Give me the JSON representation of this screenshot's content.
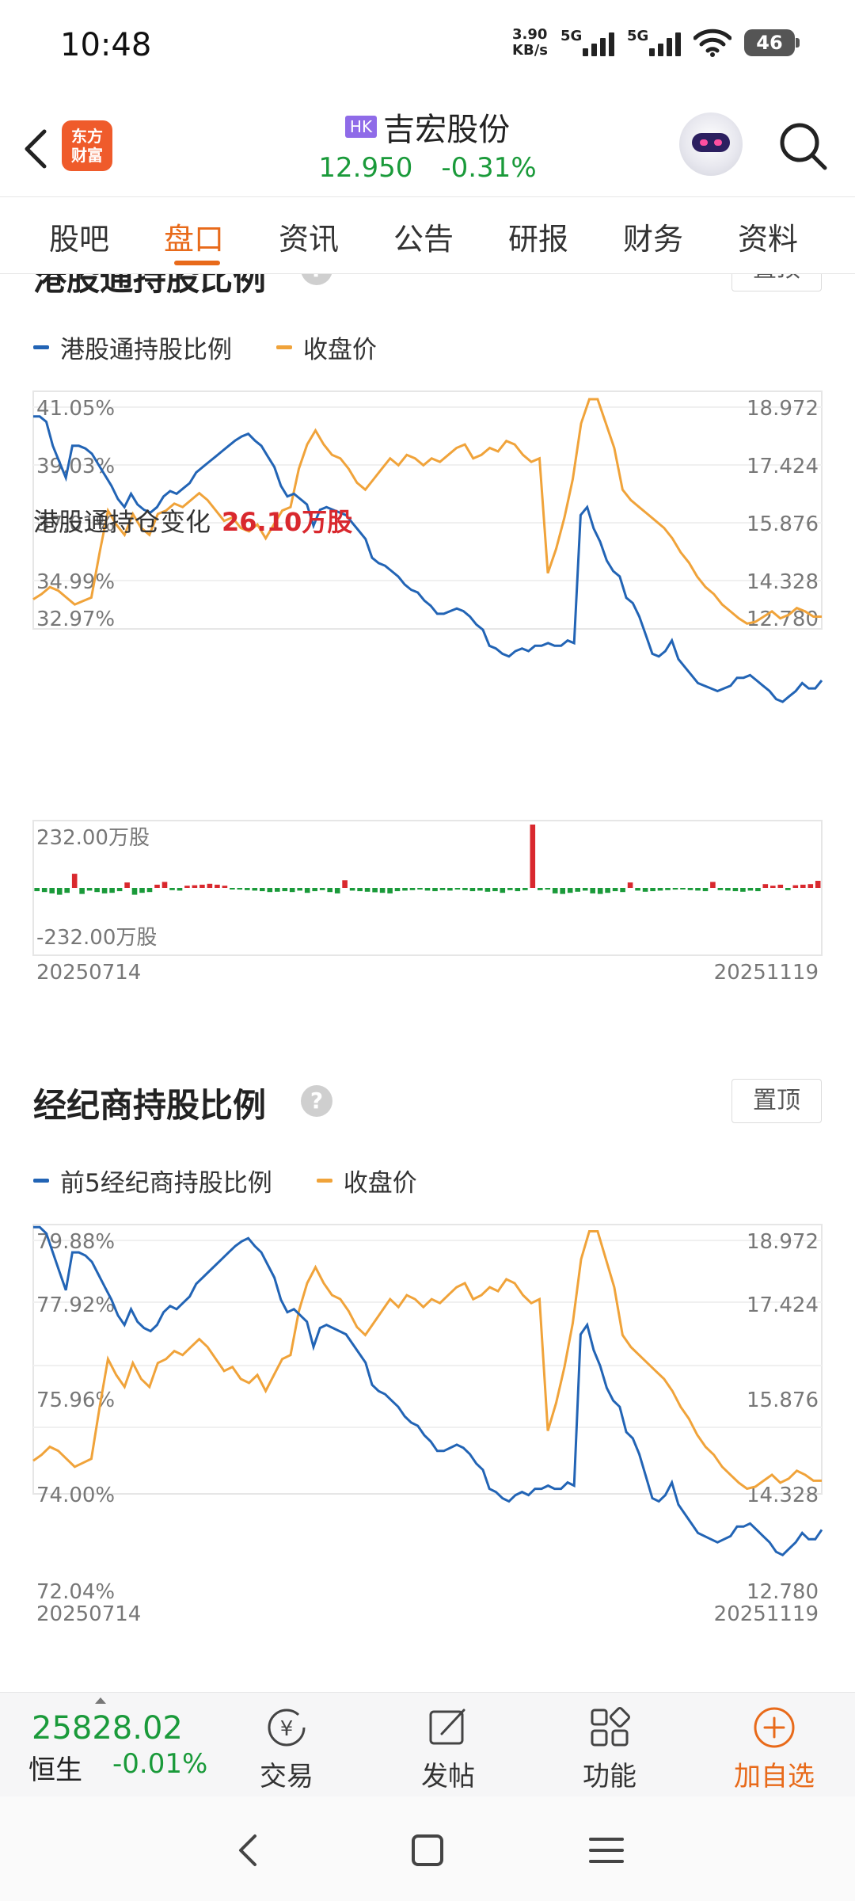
{
  "status_bar": {
    "time": "10:48",
    "net_speed_value": "3.90",
    "net_speed_unit": "KB/s",
    "sim1_label": "5G",
    "sim2_label": "5G",
    "battery": "46"
  },
  "header": {
    "logo_line1": "东方",
    "logo_line2": "财富",
    "market_badge": "HK",
    "stock_name": "吉宏股份",
    "price": "12.950",
    "change_pct": "-0.31%"
  },
  "tabs": [
    "股吧",
    "盘口",
    "资讯",
    "公告",
    "研报",
    "财务",
    "资料"
  ],
  "active_tab_index": 1,
  "colors": {
    "blue_series": "#2264b5",
    "orange_series": "#f0a33a",
    "green_down": "#1a9a3a",
    "red_up": "#d9282e",
    "accent": "#e86a1a"
  },
  "section_hk": {
    "title": "港股通持股比例",
    "pin_label": "置顶",
    "legend_blue": "港股通持股比例",
    "legend_orange": "收盘价",
    "left_ticks": [
      "41.05%",
      "39.03%",
      "37.01%",
      "34.99%",
      "32.97%"
    ],
    "right_ticks": [
      "18.972",
      "17.424",
      "15.876",
      "14.328",
      "12.780"
    ],
    "flow_label": "港股通持仓变化",
    "flow_value": "26.10万股",
    "bar_max_label": "232.00万股",
    "bar_min_label": "-232.00万股",
    "date_start": "20250714",
    "date_end": "20251119"
  },
  "section_broker": {
    "title": "经纪商持股比例",
    "pin_label": "置顶",
    "legend_blue": "前5经纪商持股比例",
    "legend_orange": "收盘价",
    "left_ticks": [
      "79.88%",
      "77.92%",
      "75.96%",
      "74.00%",
      "72.04%"
    ],
    "right_ticks": [
      "18.972",
      "17.424",
      "15.876",
      "14.328",
      "12.780"
    ],
    "date_start": "20250714",
    "date_end": "20251119"
  },
  "chart_data": [
    {
      "type": "line",
      "title": "港股通持股比例",
      "x_range": [
        "20250714",
        "20251119"
      ],
      "y_left_range": [
        32.97,
        41.05
      ],
      "y_right_range": [
        12.78,
        18.972
      ],
      "series": [
        {
          "name": "港股通持股比例",
          "axis": "left",
          "values": [
            40.7,
            40.7,
            40.5,
            39.6,
            39.0,
            38.4,
            39.6,
            39.6,
            39.5,
            39.3,
            38.9,
            38.5,
            38.1,
            37.6,
            37.3,
            37.8,
            37.4,
            37.2,
            37.1,
            37.3,
            37.7,
            37.9,
            37.8,
            38.0,
            38.2,
            38.6,
            38.8,
            39.0,
            39.2,
            39.4,
            39.6,
            39.8,
            39.95,
            40.05,
            39.8,
            39.6,
            39.2,
            38.8,
            38.1,
            37.7,
            37.8,
            37.6,
            37.4,
            36.6,
            37.2,
            37.3,
            37.2,
            37.1,
            37.0,
            36.7,
            36.4,
            36.1,
            35.4,
            35.2,
            35.1,
            34.9,
            34.7,
            34.4,
            34.2,
            34.1,
            33.8,
            33.6,
            33.3,
            33.3,
            33.4,
            33.5,
            33.4,
            33.2,
            32.9,
            32.7,
            32.1,
            32.0,
            31.8,
            31.7,
            31.9,
            32.0,
            31.9,
            32.1,
            32.1,
            32.2,
            32.1,
            32.1,
            32.3,
            32.2,
            37.0,
            37.3,
            36.5,
            36.0,
            35.3,
            34.9,
            34.7,
            33.9,
            33.7,
            33.2,
            32.5,
            31.8,
            31.7,
            31.9,
            32.3,
            31.6,
            31.3,
            31.0,
            30.7,
            30.6,
            30.5,
            30.4,
            30.5,
            30.6,
            30.9,
            30.9,
            31.0,
            30.8,
            30.6,
            30.4,
            30.1,
            30.0,
            30.2,
            30.4,
            30.7,
            30.5,
            30.5,
            30.8
          ]
        },
        {
          "name": "收盘价",
          "axis": "right",
          "values": [
            13.45,
            13.6,
            13.8,
            13.7,
            13.5,
            13.3,
            13.4,
            13.5,
            14.8,
            16.0,
            15.6,
            15.3,
            15.9,
            15.5,
            15.3,
            15.9,
            16.0,
            16.2,
            16.1,
            16.3,
            16.5,
            16.3,
            16.0,
            15.7,
            15.8,
            15.5,
            15.4,
            15.6,
            15.2,
            15.6,
            16.0,
            16.1,
            17.2,
            17.9,
            18.3,
            17.9,
            17.6,
            17.5,
            17.2,
            16.8,
            16.6,
            16.9,
            17.2,
            17.5,
            17.3,
            17.6,
            17.5,
            17.3,
            17.5,
            17.4,
            17.6,
            17.8,
            17.9,
            17.5,
            17.6,
            17.8,
            17.7,
            18.0,
            17.9,
            17.6,
            17.4,
            17.5,
            14.2,
            14.9,
            15.8,
            16.9,
            18.5,
            19.2,
            19.2,
            18.5,
            17.8,
            16.6,
            16.3,
            16.1,
            15.9,
            15.7,
            15.5,
            15.2,
            14.8,
            14.5,
            14.1,
            13.8,
            13.6,
            13.3,
            13.1,
            12.9,
            12.75,
            12.8,
            12.95,
            13.1,
            12.9,
            13.0,
            13.2,
            13.1,
            12.95,
            12.95
          ]
        }
      ]
    },
    {
      "type": "bar",
      "title": "港股通持仓变化",
      "x_range": [
        "20250714",
        "20251119"
      ],
      "y_range": [
        -232.0,
        232.0
      ],
      "unit": "万股",
      "values": [
        -12,
        -15,
        -20,
        -25,
        -18,
        52,
        -22,
        -10,
        -15,
        -20,
        -18,
        -12,
        20,
        -25,
        -18,
        -15,
        12,
        22,
        -8,
        -10,
        8,
        10,
        12,
        15,
        12,
        8,
        -5,
        -6,
        -8,
        -10,
        -12,
        -15,
        -14,
        -12,
        -15,
        -10,
        -18,
        -12,
        -8,
        -15,
        -20,
        28,
        -10,
        -12,
        -14,
        -16,
        -18,
        -20,
        -12,
        -10,
        -8,
        -6,
        -10,
        -12,
        -8,
        -10,
        -6,
        -8,
        -12,
        -10,
        -14,
        -12,
        -18,
        -8,
        -12,
        -8,
        232,
        -8,
        -6,
        -20,
        -22,
        -18,
        -14,
        -10,
        -20,
        -22,
        -18,
        -12,
        -15,
        20,
        -10,
        -14,
        -12,
        -10,
        -8,
        -6,
        -5,
        -8,
        -10,
        -12,
        22,
        -8,
        -10,
        -12,
        -14,
        -10,
        -12,
        14,
        8,
        12,
        -8,
        10,
        12,
        14,
        26
      ]
    },
    {
      "type": "line",
      "title": "经纪商持股比例",
      "x_range": [
        "20250714",
        "20251119"
      ],
      "y_left_range": [
        72.04,
        79.88
      ],
      "y_right_range": [
        12.78,
        18.972
      ],
      "series": [
        {
          "name": "前5经纪商持股比例",
          "axis": "left",
          "values": [
            80.3,
            80.3,
            80.1,
            79.5,
            78.9,
            78.3,
            79.5,
            79.5,
            79.4,
            79.2,
            78.8,
            78.4,
            78.0,
            77.5,
            77.2,
            77.7,
            77.3,
            77.1,
            77.0,
            77.2,
            77.6,
            77.8,
            77.7,
            77.9,
            78.1,
            78.5,
            78.7,
            78.9,
            79.1,
            79.3,
            79.5,
            79.7,
            79.85,
            79.95,
            79.7,
            79.5,
            79.1,
            78.7,
            78.0,
            77.6,
            77.7,
            77.5,
            77.3,
            76.5,
            77.1,
            77.2,
            77.1,
            77.0,
            76.9,
            76.6,
            76.3,
            76.0,
            75.3,
            75.1,
            75.0,
            74.8,
            74.6,
            74.3,
            74.1,
            74.0,
            73.7,
            73.5,
            73.2,
            73.2,
            73.3,
            73.4,
            73.3,
            73.1,
            72.8,
            72.6,
            72.0,
            71.9,
            71.7,
            71.6,
            71.8,
            71.9,
            71.8,
            72.0,
            72.0,
            72.1,
            72.0,
            72.0,
            72.2,
            72.1,
            76.9,
            77.2,
            76.4,
            75.9,
            75.2,
            74.8,
            74.6,
            73.8,
            73.6,
            73.1,
            72.4,
            71.7,
            71.6,
            71.8,
            72.2,
            71.5,
            71.2,
            70.9,
            70.6,
            70.5,
            70.4,
            70.3,
            70.4,
            70.5,
            70.8,
            70.8,
            70.9,
            70.7,
            70.5,
            70.3,
            70.0,
            69.9,
            70.1,
            70.3,
            70.6,
            70.4,
            70.4,
            70.7
          ]
        },
        {
          "name": "收盘价",
          "axis": "right",
          "values": [
            13.45,
            13.6,
            13.8,
            13.7,
            13.5,
            13.3,
            13.4,
            13.5,
            14.8,
            16.0,
            15.6,
            15.3,
            15.9,
            15.5,
            15.3,
            15.9,
            16.0,
            16.2,
            16.1,
            16.3,
            16.5,
            16.3,
            16.0,
            15.7,
            15.8,
            15.5,
            15.4,
            15.6,
            15.2,
            15.6,
            16.0,
            16.1,
            17.2,
            17.9,
            18.3,
            17.9,
            17.6,
            17.5,
            17.2,
            16.8,
            16.6,
            16.9,
            17.2,
            17.5,
            17.3,
            17.6,
            17.5,
            17.3,
            17.5,
            17.4,
            17.6,
            17.8,
            17.9,
            17.5,
            17.6,
            17.8,
            17.7,
            18.0,
            17.9,
            17.6,
            17.4,
            17.5,
            14.2,
            14.9,
            15.8,
            16.9,
            18.5,
            19.2,
            19.2,
            18.5,
            17.8,
            16.6,
            16.3,
            16.1,
            15.9,
            15.7,
            15.5,
            15.2,
            14.8,
            14.5,
            14.1,
            13.8,
            13.6,
            13.3,
            13.1,
            12.9,
            12.75,
            12.8,
            12.95,
            13.1,
            12.9,
            13.0,
            13.2,
            13.1,
            12.95,
            12.95
          ]
        }
      ]
    }
  ],
  "bottom_bar": {
    "index_value": "25828.02",
    "index_name": "恒生",
    "index_change": "-0.01%",
    "trade_label": "交易",
    "post_label": "发帖",
    "features_label": "功能",
    "add_label": "加自选"
  }
}
